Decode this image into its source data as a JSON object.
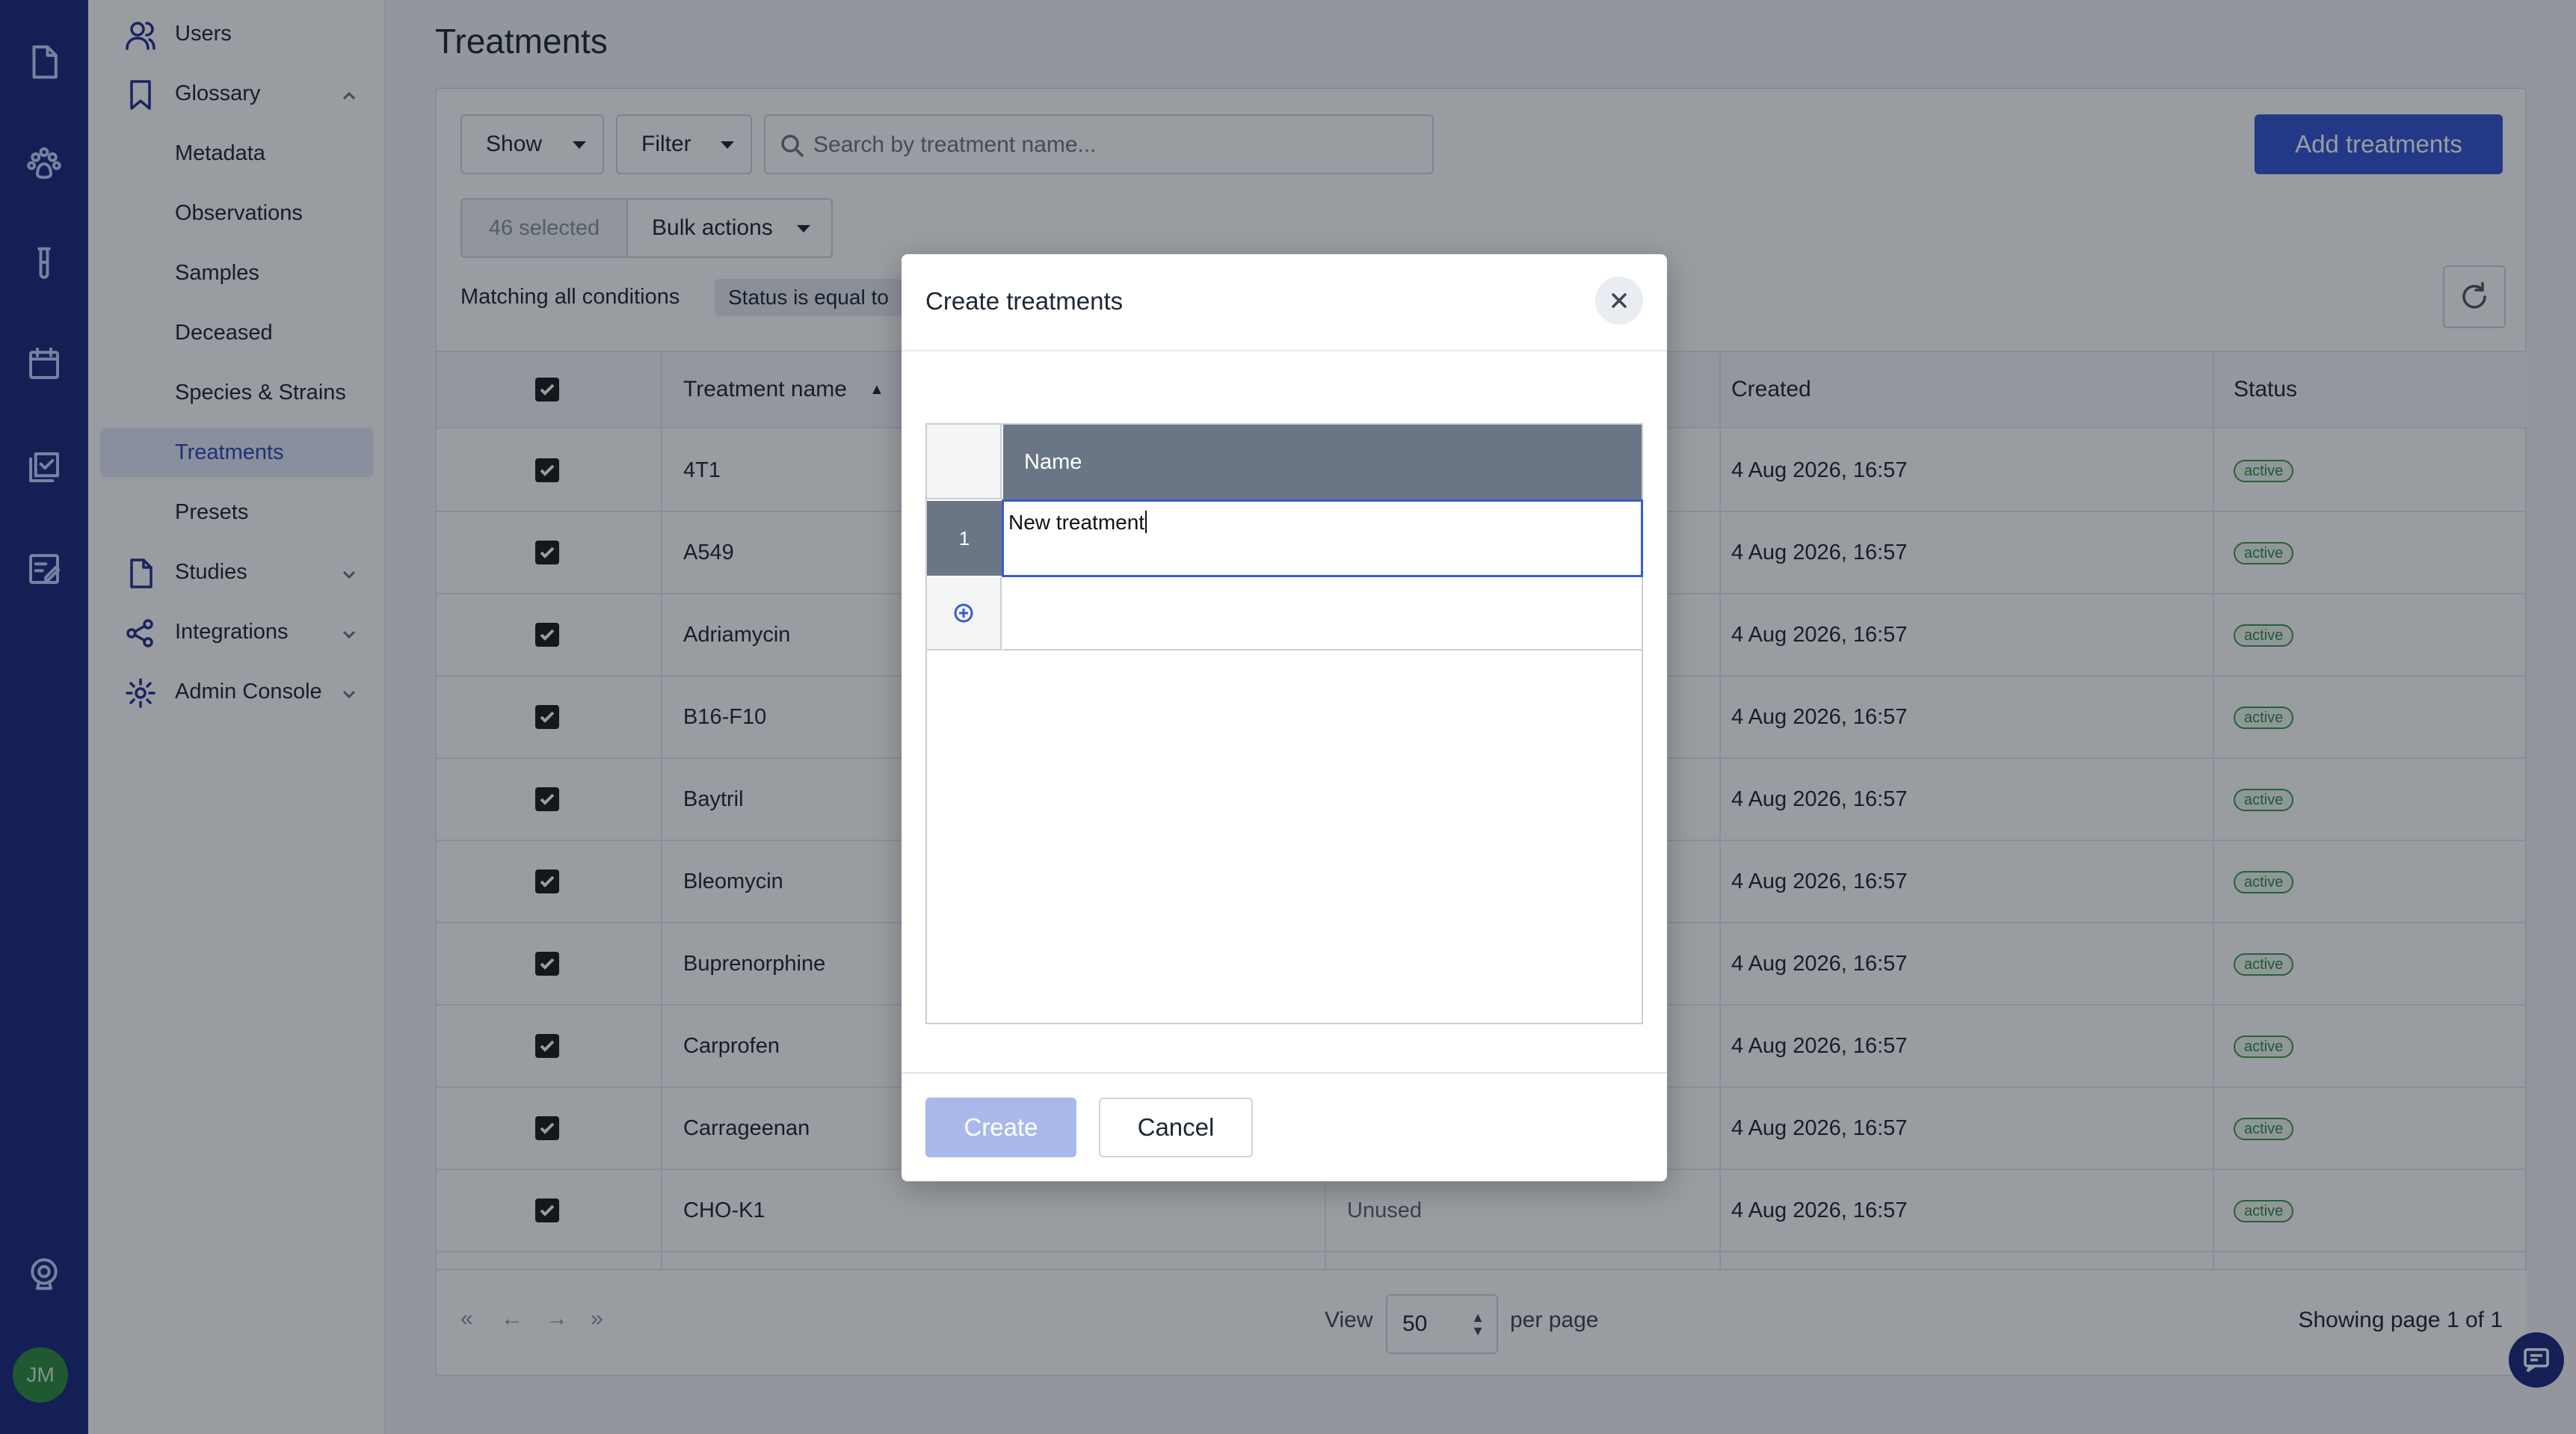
{
  "rail": {
    "icons": [
      "document-icon",
      "paw-icon",
      "test-tube-icon",
      "calendar-icon",
      "checklist-icon",
      "edit-note-icon",
      "support-icon"
    ],
    "avatar_initials": "JM"
  },
  "sidebar": {
    "items": [
      {
        "label": "Users",
        "icon": "users-icon"
      },
      {
        "label": "Glossary",
        "icon": "bookmark-icon",
        "expanded": true
      },
      {
        "label": "Metadata"
      },
      {
        "label": "Observations"
      },
      {
        "label": "Samples"
      },
      {
        "label": "Deceased"
      },
      {
        "label": "Species & Strains"
      },
      {
        "label": "Treatments",
        "active": true
      },
      {
        "label": "Presets"
      },
      {
        "label": "Studies",
        "icon": "document-icon"
      },
      {
        "label": "Integrations",
        "icon": "share-icon"
      },
      {
        "label": "Admin Console",
        "icon": "gear-icon"
      }
    ]
  },
  "page": {
    "title": "Treatments"
  },
  "toolbar": {
    "show_label": "Show",
    "filter_label": "Filter",
    "search_placeholder": "Search by treatment name...",
    "add_label": "Add treatments",
    "selected_label": "46 selected",
    "bulk_label": "Bulk actions",
    "conditions_label": "Matching all conditions",
    "condition_chip": "Status is equal to"
  },
  "table": {
    "headers": {
      "name": "Treatment name",
      "created": "Created",
      "status": "Status"
    },
    "rows": [
      {
        "name": "4T1",
        "usage": "",
        "created": "4 Aug 2026, 16:57",
        "status": "active"
      },
      {
        "name": "A549",
        "usage": "",
        "created": "4 Aug 2026, 16:57",
        "status": "active"
      },
      {
        "name": "Adriamycin",
        "usage": "",
        "created": "4 Aug 2026, 16:57",
        "status": "active"
      },
      {
        "name": "B16-F10",
        "usage": "",
        "created": "4 Aug 2026, 16:57",
        "status": "active"
      },
      {
        "name": "Baytril",
        "usage": "",
        "created": "4 Aug 2026, 16:57",
        "status": "active"
      },
      {
        "name": "Bleomycin",
        "usage": "",
        "created": "4 Aug 2026, 16:57",
        "status": "active"
      },
      {
        "name": "Buprenorphine",
        "usage": "",
        "created": "4 Aug 2026, 16:57",
        "status": "active"
      },
      {
        "name": "Carprofen",
        "usage": "",
        "created": "4 Aug 2026, 16:57",
        "status": "active"
      },
      {
        "name": "Carrageenan",
        "usage": "",
        "created": "4 Aug 2026, 16:57",
        "status": "active"
      },
      {
        "name": "CHO-K1",
        "usage": "Unused",
        "created": "4 Aug 2026, 16:57",
        "status": "active"
      }
    ]
  },
  "pagination": {
    "first": "«",
    "prev": "←",
    "next": "→",
    "last": "»",
    "view_label": "View",
    "per_page_value": "50",
    "per_page_label": "per page",
    "showing": "Showing page 1 of 1"
  },
  "modal": {
    "title": "Create treatments",
    "grid": {
      "column_header": "Name",
      "row_number": "1",
      "cell_value": "New treatment"
    },
    "create_label": "Create",
    "cancel_label": "Cancel"
  },
  "colors": {
    "rail": "#1b2a7d",
    "primary": "#3453d1",
    "badge_green": "#2f8a3e"
  }
}
